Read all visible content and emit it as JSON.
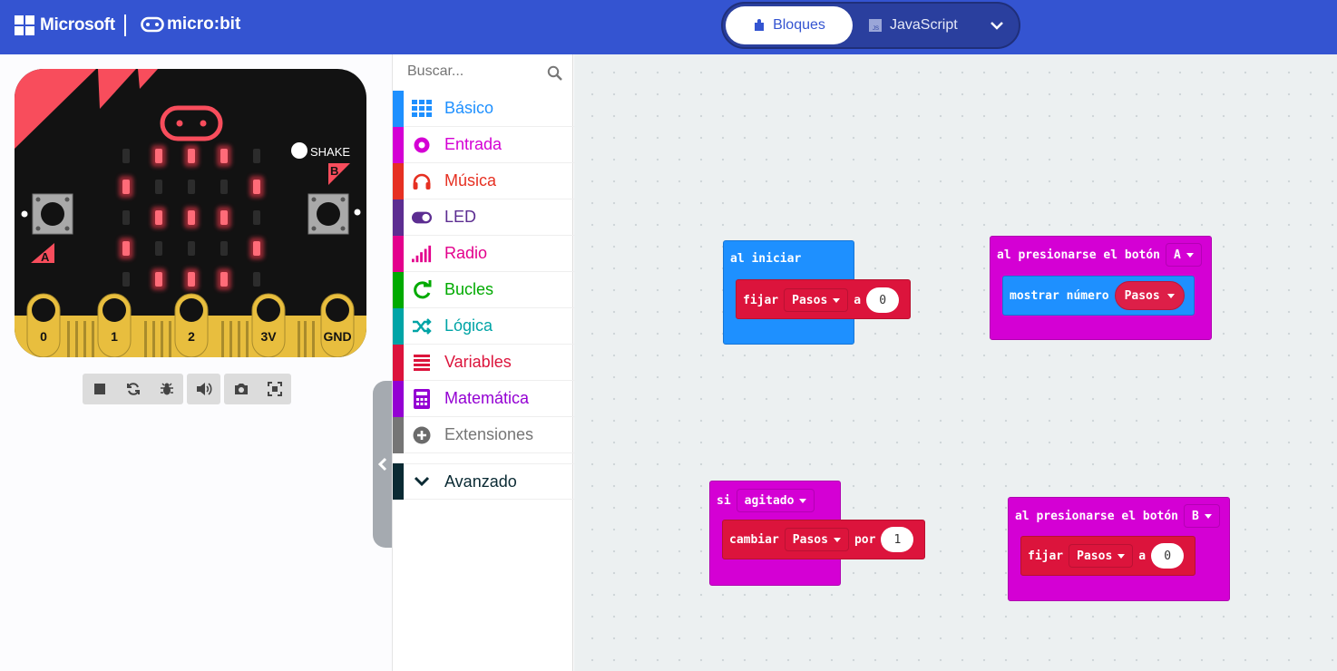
{
  "header": {
    "brand": "Microsoft",
    "product": "micro:bit",
    "tabs": [
      {
        "label": "Bloques",
        "icon": "puzzle-icon"
      },
      {
        "label": "JavaScript",
        "icon": "js-file-icon"
      }
    ]
  },
  "simulator": {
    "board": {
      "shake_label": "SHAKE",
      "button_a": "A",
      "button_b": "B",
      "pins": [
        "0",
        "1",
        "2",
        "3V",
        "GND"
      ]
    },
    "toolbar": [
      "stop-icon",
      "restart-icon",
      "debug-icon",
      "sound-icon",
      "screenshot-icon",
      "fullscreen-icon"
    ]
  },
  "toolbox": {
    "search_placeholder": "Buscar...",
    "categories": [
      {
        "label": "Básico",
        "color": "#1e90ff",
        "icon": "grid-icon"
      },
      {
        "label": "Entrada",
        "color": "#d400d4",
        "icon": "target-icon"
      },
      {
        "label": "Música",
        "color": "#e63022",
        "icon": "headphones-icon"
      },
      {
        "label": "LED",
        "color": "#5c2d91",
        "icon": "toggle-icon"
      },
      {
        "label": "Radio",
        "color": "#e3008c",
        "icon": "signal-icon"
      },
      {
        "label": "Bucles",
        "color": "#00aa00",
        "icon": "refresh-icon"
      },
      {
        "label": "Lógica",
        "color": "#00a4a6",
        "icon": "shuffle-icon"
      },
      {
        "label": "Variables",
        "color": "#dc143c",
        "icon": "list-icon"
      },
      {
        "label": "Matemática",
        "color": "#9400d3",
        "icon": "calculator-icon"
      },
      {
        "label": "Extensiones",
        "color": "#757575",
        "icon": "plus-circle-icon"
      }
    ],
    "advanced": {
      "label": "Avanzado",
      "color": "#0a2a33",
      "icon": "chevron-down-icon"
    }
  },
  "blocks": {
    "on_start": {
      "label": "al iniciar",
      "set": "fijar",
      "variable": "Pasos",
      "to": "a",
      "value": "0"
    },
    "button_a": {
      "label": "al presionarse el botón",
      "button": "A",
      "show": "mostrar número",
      "variable": "Pasos"
    },
    "shake": {
      "label": "si",
      "gesture": "agitado",
      "change": "cambiar",
      "variable": "Pasos",
      "by": "por",
      "value": "1"
    },
    "button_b": {
      "label": "al presionarse el botón",
      "button": "B",
      "set": "fijar",
      "variable": "Pasos",
      "to": "a",
      "value": "0"
    }
  }
}
